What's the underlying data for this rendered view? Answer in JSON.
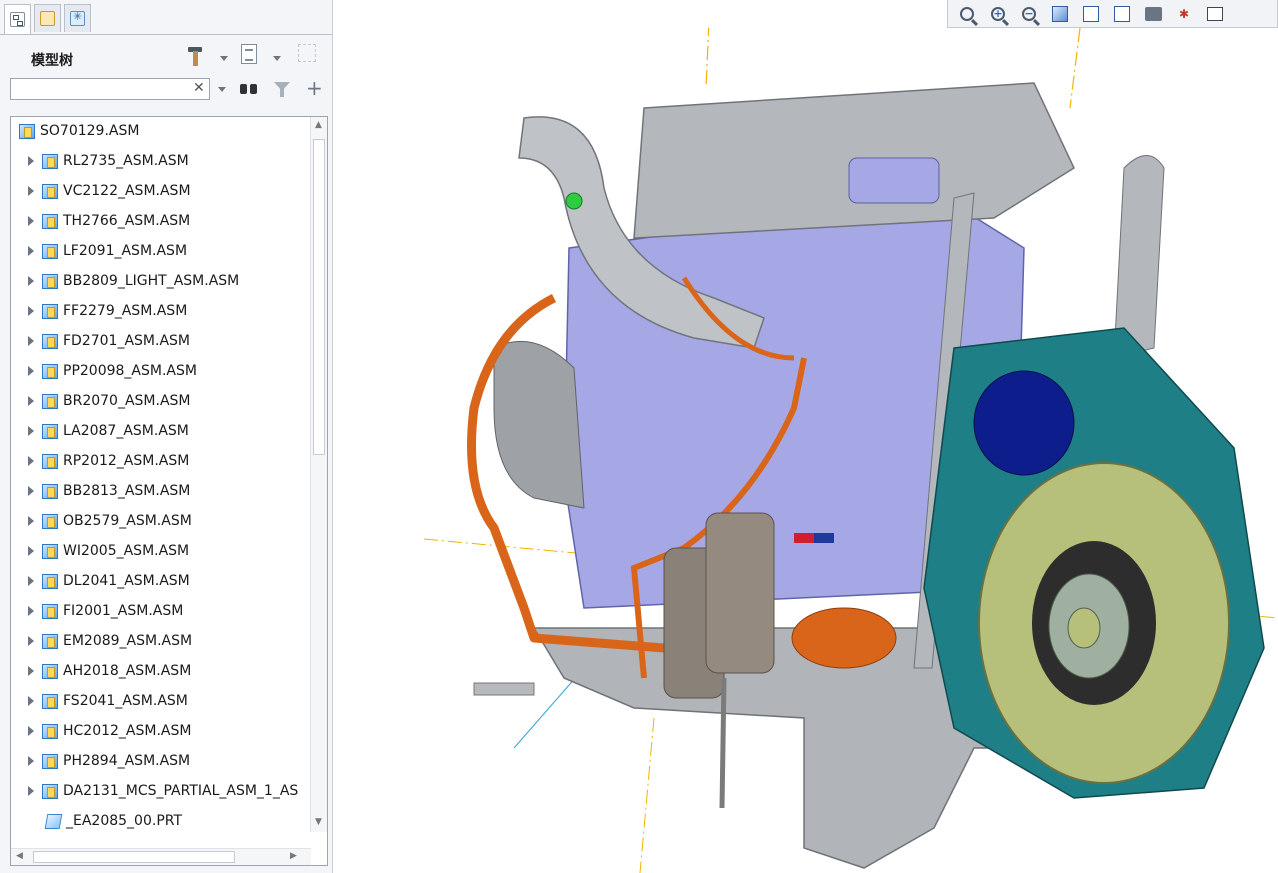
{
  "left_panel": {
    "tabs": [
      {
        "icon": "model-tree-icon"
      },
      {
        "icon": "layers-icon"
      },
      {
        "icon": "favorites-icon"
      }
    ],
    "title": "模型树",
    "header_icons": [
      "settings-hammer-icon",
      "tree-filter-list-icon",
      "grid-columns-icon"
    ],
    "search": {
      "value": "",
      "placeholder": ""
    },
    "tree": {
      "root": "SO70129.ASM",
      "items": [
        "RL2735_ASM.ASM",
        "VC2122_ASM.ASM",
        "TH2766_ASM.ASM",
        "LF2091_ASM.ASM",
        "BB2809_LIGHT_ASM.ASM",
        "FF2279_ASM.ASM",
        "FD2701_ASM.ASM",
        "PP20098_ASM.ASM",
        "BR2070_ASM.ASM",
        "LA2087_ASM.ASM",
        "RP2012_ASM.ASM",
        "BB2813_ASM.ASM",
        "OB2579_ASM.ASM",
        "WI2005_ASM.ASM",
        "DL2041_ASM.ASM",
        "FI2001_ASM.ASM",
        "EM2089_ASM.ASM",
        "AH2018_ASM.ASM",
        "FS2041_ASM.ASM",
        "HC2012_ASM.ASM",
        "PH2894_ASM.ASM",
        "DA2131_MCS_PARTIAL_ASM_1_AS"
      ],
      "last_part": "_EA2085_00.PRT"
    }
  },
  "toolbar": {
    "buttons": [
      "refit-icon",
      "zoom-in-icon",
      "zoom-out-icon",
      "repaint-icon",
      "display-style-icon",
      "saved-views-icon",
      "view-manager-icon",
      "datum-display-icon",
      "spin-center-icon",
      "annotation-icon"
    ]
  },
  "colors": {
    "block": "#a6a8e6",
    "casting": "#b4b7bc",
    "harness": "#d9651b",
    "flywheel_housing": "#1f7f86",
    "flywheel": "#b6c07a",
    "datum": "#f0b400"
  }
}
